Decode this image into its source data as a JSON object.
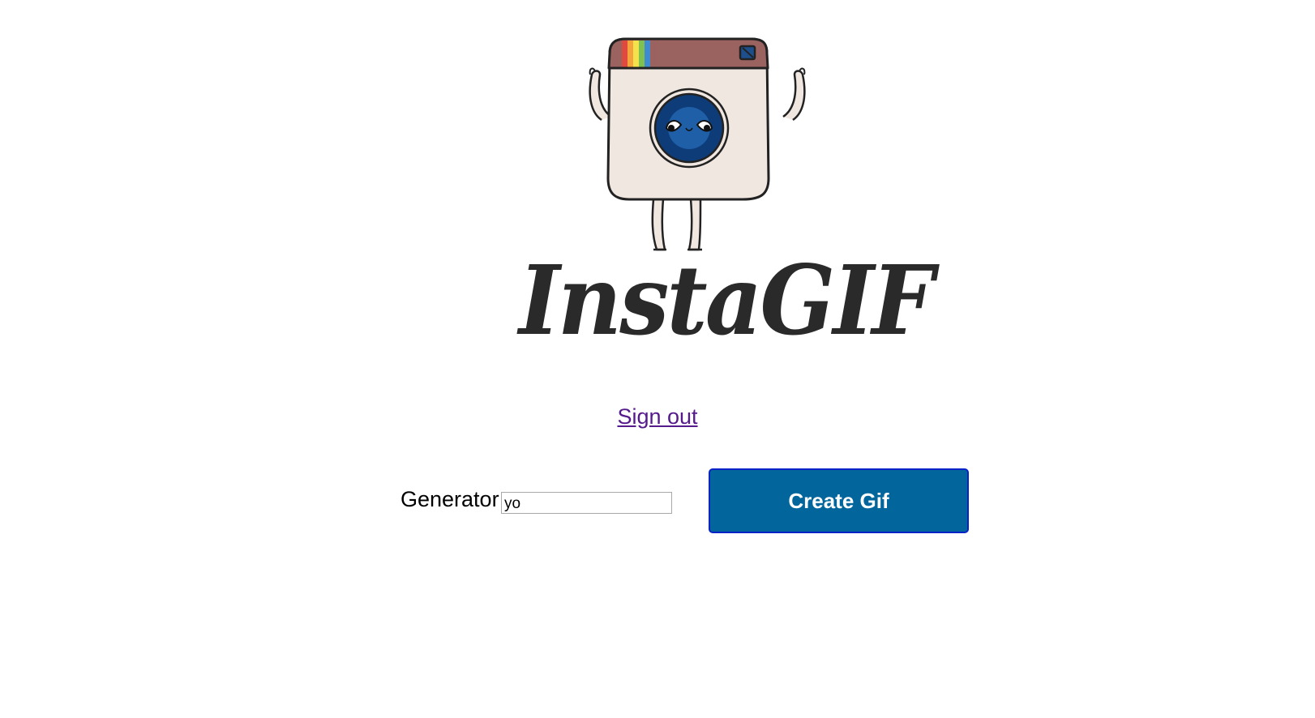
{
  "logo": {
    "text": "InstaGIF",
    "mascot": "camera-mascot-icon"
  },
  "auth": {
    "signout_label": "Sign out",
    "link_color": "#551a8b"
  },
  "form": {
    "generator_label": "Generator",
    "generator_value": "yo",
    "create_button_label": "Create Gif",
    "button_color": "#02669d",
    "button_border_color": "#0723c7"
  }
}
